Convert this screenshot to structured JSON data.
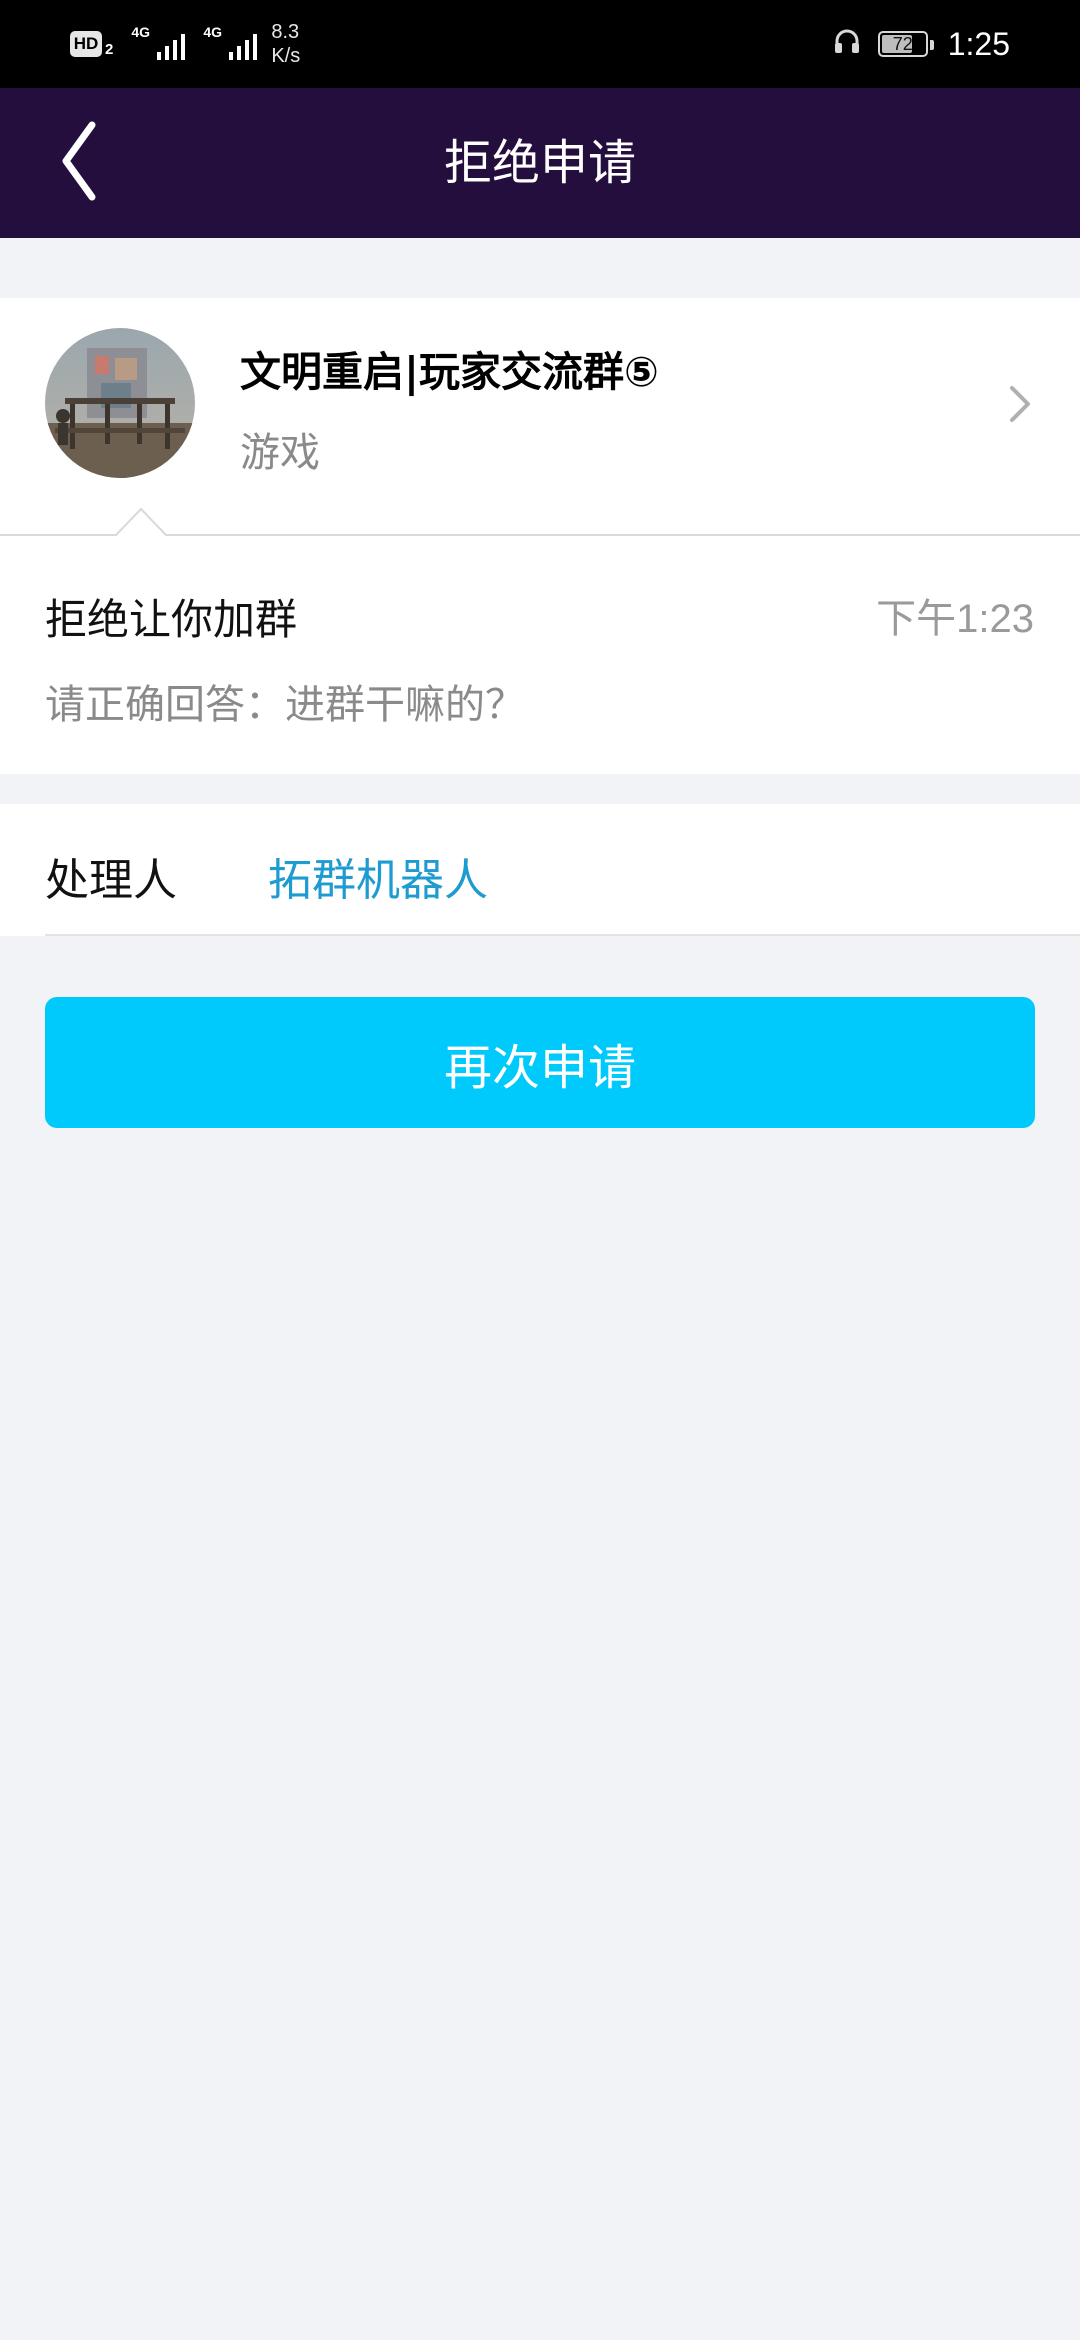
{
  "status_bar": {
    "hd_label": "HD",
    "hd_sub": "2",
    "signal1_label": "4G",
    "signal2_label": "4G",
    "net_speed_value": "8.3",
    "net_speed_unit": "K/s",
    "battery_level": "72",
    "battery_fraction": 0.72,
    "time": "1:25"
  },
  "nav": {
    "title": "拒绝申请",
    "back_icon": "chevron-left-icon"
  },
  "group": {
    "name": "文明重启|玩家交流群⑤",
    "category": "游戏",
    "chevron_icon": "chevron-right-icon"
  },
  "message": {
    "title": "拒绝让你加群",
    "time": "下午1:23",
    "detail": "请正确回答：进群干嘛的？"
  },
  "handler": {
    "label": "处理人",
    "name": "拓群机器人"
  },
  "actions": {
    "reapply_label": "再次申请"
  },
  "colors": {
    "nav_bg": "#230e3e",
    "accent_button": "#00cafc",
    "link": "#1e9bd1",
    "page_bg": "#f2f3f7"
  }
}
